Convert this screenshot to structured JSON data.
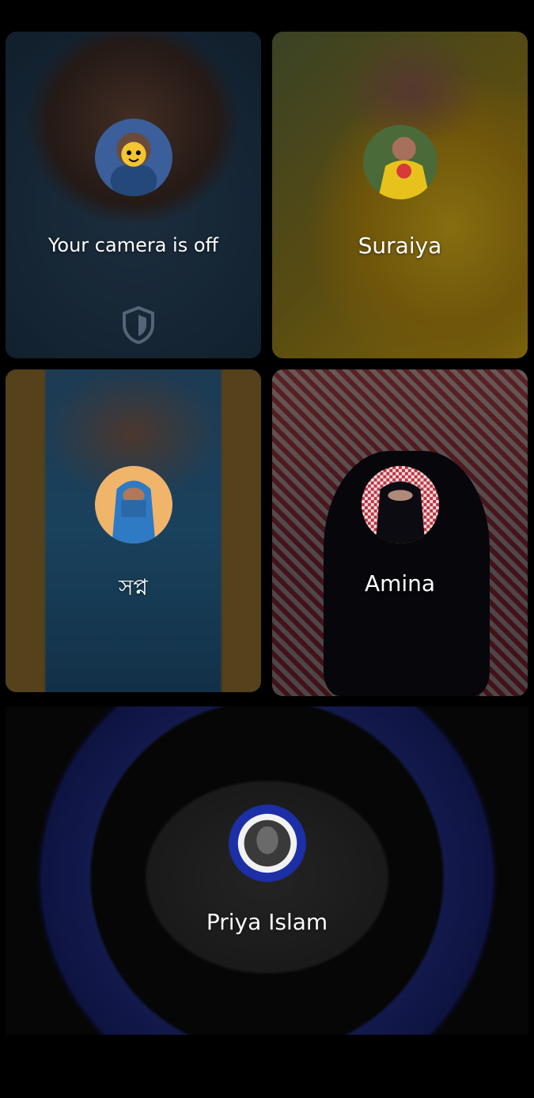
{
  "tiles": [
    {
      "id": "you",
      "label": "Your camera is off"
    },
    {
      "id": "suraiya",
      "label": "Suraiya"
    },
    {
      "id": "swapno",
      "label": "সপ্ন"
    },
    {
      "id": "amina",
      "label": "Amina"
    },
    {
      "id": "priya",
      "label": "Priya Islam"
    }
  ],
  "icons": {
    "camera_off_badge": "shield-icon"
  },
  "colors": {
    "background": "#000000",
    "label_text": "#ffffff"
  }
}
